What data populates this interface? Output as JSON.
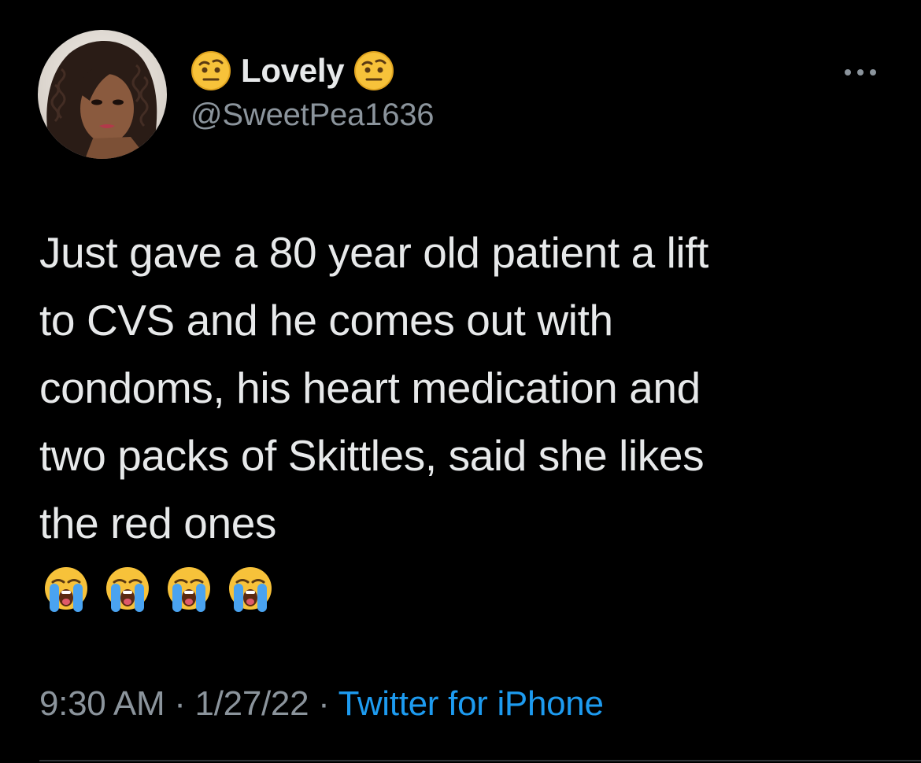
{
  "user": {
    "display_name": "Lovely",
    "handle": "@SweetPea1636",
    "name_emoji_icon": "face-with-raised-eyebrow-icon"
  },
  "tweet": {
    "lines": [
      "Just gave a 80 year old patient a lift",
      "to CVS and he comes out with",
      "condoms, his heart medication and",
      "two packs of Skittles, said she likes",
      "the red ones"
    ],
    "emoji_icons": [
      "loudly-crying-face-icon",
      "loudly-crying-face-icon",
      "loudly-crying-face-icon",
      "loudly-crying-face-icon"
    ]
  },
  "meta": {
    "time": "9:30 AM",
    "separator": " · ",
    "date": "1/27/22",
    "source": "Twitter for iPhone"
  },
  "colors": {
    "background": "#000000",
    "text": "#e7e9ea",
    "secondary": "#8b949c",
    "link": "#1d9bf0"
  }
}
